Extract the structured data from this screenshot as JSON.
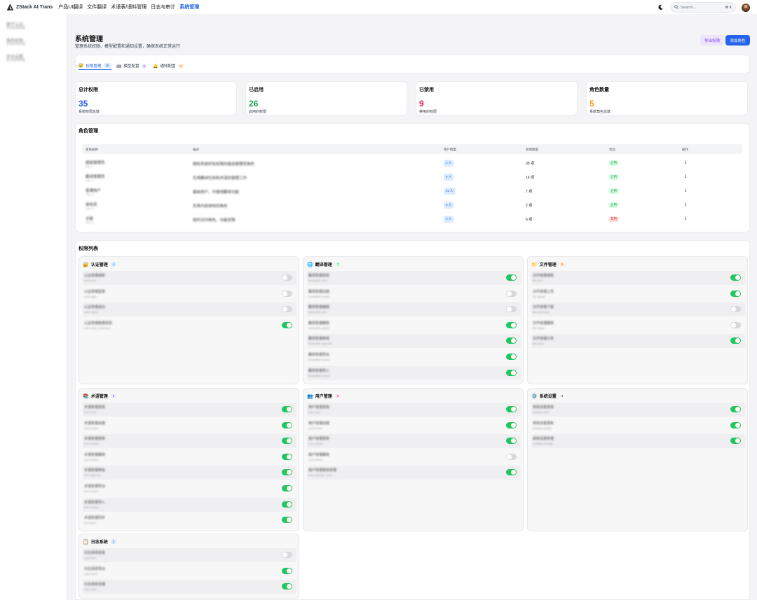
{
  "app": {
    "name": "ZStack AI Trans"
  },
  "nav": [
    {
      "label": "产品UI翻译",
      "active": false
    },
    {
      "label": "文件翻译",
      "active": false
    },
    {
      "label": "术语表/语料管理",
      "active": false
    },
    {
      "label": "日志与审计",
      "active": false
    },
    {
      "label": "系统管理",
      "active": true
    }
  ],
  "search": {
    "placeholder": "Search...",
    "shortcut": "⌘ K"
  },
  "sidebar": {
    "items": [
      {
        "title": "基于认证",
        "sub": "系统基础配置"
      },
      {
        "title": "角色权限",
        "sub": "系统权限管理"
      },
      {
        "title": "安全设置",
        "sub": "安全策略配置"
      }
    ]
  },
  "page": {
    "title": "系统管理",
    "subtitle": "管理系统权限、模型配置和通知设置，确保系统正常运行",
    "export_label": "导出权限",
    "add_label": "添加角色"
  },
  "tabs": [
    {
      "icon": "🔐",
      "label": "权限管理",
      "count": "35",
      "active": true
    },
    {
      "icon": "🤖",
      "label": "模型配置",
      "count": "6",
      "active": false
    },
    {
      "icon": "🔔",
      "label": "通知配置",
      "count": "3",
      "active": false
    }
  ],
  "stats": [
    {
      "label": "总计权限",
      "value": "35",
      "desc": "系统权限总数",
      "color": "#2563eb"
    },
    {
      "label": "已启用",
      "value": "26",
      "desc": "启用的权限",
      "color": "#16a34a"
    },
    {
      "label": "已禁用",
      "value": "9",
      "desc": "禁用的权限",
      "color": "#e11d48"
    },
    {
      "label": "角色数量",
      "value": "5",
      "desc": "系统角色总数",
      "color": "#f59e0b"
    }
  ],
  "roles": {
    "title": "角色管理",
    "headers": [
      "角色名称",
      "描述",
      "用户数量",
      "权限数量",
      "状态",
      "操作"
    ],
    "rows": [
      {
        "name": "超级管理员",
        "code": "role_1",
        "desc": "拥有系统所有权限的最高管理员角色",
        "users": "2 人",
        "perms": "35 项",
        "status": "启用",
        "enabled": true
      },
      {
        "name": "翻译管理员",
        "code": "role_2",
        "desc": "负责翻译任务和术语的管理工作",
        "users": "5 人",
        "perms": "16 项",
        "status": "启用",
        "enabled": true
      },
      {
        "name": "普通用户",
        "code": "role_3",
        "desc": "基础用户，可使用翻译功能",
        "users": "25 人",
        "perms": "7 项",
        "status": "启用",
        "enabled": true
      },
      {
        "name": "审核员",
        "code": "role_4",
        "desc": "负责内容审核的角色",
        "users": "8 人",
        "perms": "2 项",
        "status": "启用",
        "enabled": true
      },
      {
        "name": "访客",
        "code": "role_5",
        "desc": "临时访问角色，功能受限",
        "users": "3 人",
        "perms": "6 项",
        "status": "禁用",
        "enabled": false
      }
    ]
  },
  "permissions": {
    "title": "权限列表",
    "groups": [
      {
        "icon": "🔐",
        "name": "认证管理",
        "count": "4",
        "count_bg": "#dbeafe",
        "count_color": "#2563eb",
        "items": [
          {
            "name": "认证管理读取",
            "code": "auth.read",
            "on": false
          },
          {
            "name": "认证管理登录",
            "code": "auth.login",
            "on": false
          },
          {
            "name": "认证管理退出",
            "code": "auth.logout",
            "on": false
          },
          {
            "name": "认证管理重置密码",
            "code": "auth.reset_password",
            "on": true
          }
        ]
      },
      {
        "icon": "🌐",
        "name": "翻译管理",
        "count": "7",
        "count_bg": "#dcfce7",
        "count_color": "#16a34a",
        "items": [
          {
            "name": "翻译管理查看",
            "code": "translation.view",
            "on": true
          },
          {
            "name": "翻译管理创建",
            "code": "translation.create",
            "on": false
          },
          {
            "name": "翻译管理编辑",
            "code": "translation.edit",
            "on": false
          },
          {
            "name": "翻译管理删除",
            "code": "translation.delete",
            "on": true
          },
          {
            "name": "翻译管理审核",
            "code": "translation.approve",
            "on": true
          },
          {
            "name": "翻译管理导出",
            "code": "translation.export",
            "on": true
          },
          {
            "name": "翻译管理导入",
            "code": "translation.import",
            "on": true
          }
        ]
      },
      {
        "icon": "📁",
        "name": "文件管理",
        "count": "5",
        "count_bg": "#ffedd5",
        "count_color": "#ea580c",
        "items": [
          {
            "name": "文件管理读取",
            "code": "file.read",
            "on": true
          },
          {
            "name": "文件管理上传",
            "code": "file.upload",
            "on": true
          },
          {
            "name": "文件管理下载",
            "code": "file.download",
            "on": false
          },
          {
            "name": "文件管理删除",
            "code": "file.delete",
            "on": false
          },
          {
            "name": "文件管理分享",
            "code": "file.share",
            "on": true
          }
        ]
      },
      {
        "icon": "📚",
        "name": "术语管理",
        "count": "8",
        "count_bg": "#ede9fe",
        "count_color": "#7c3aed",
        "items": [
          {
            "name": "术语管理查看",
            "code": "term.view",
            "on": true
          },
          {
            "name": "术语管理创建",
            "code": "term.create",
            "on": true
          },
          {
            "name": "术语管理更新",
            "code": "term.update",
            "on": true
          },
          {
            "name": "术语管理删除",
            "code": "term.delete",
            "on": true
          },
          {
            "name": "术语管理审批",
            "code": "term.approve",
            "on": true
          },
          {
            "name": "术语管理导出",
            "code": "term.export",
            "on": true
          },
          {
            "name": "术语管理导入",
            "code": "term.import",
            "on": true
          },
          {
            "name": "术语管理同步",
            "code": "term.sync",
            "on": true
          }
        ]
      },
      {
        "icon": "👥",
        "name": "用户管理",
        "count": "5",
        "count_bg": "#fce7f3",
        "count_color": "#db2777",
        "items": [
          {
            "name": "用户管理查看",
            "code": "user.view",
            "on": true
          },
          {
            "name": "用户管理创建",
            "code": "user.create",
            "on": true
          },
          {
            "name": "用户管理更新",
            "code": "user.update",
            "on": true
          },
          {
            "name": "用户管理删除",
            "code": "user.delete",
            "on": false
          },
          {
            "name": "用户管理角色管理",
            "code": "user.manage_roles",
            "on": true
          }
        ]
      },
      {
        "icon": "⚙️",
        "name": "系统设置",
        "count": "3",
        "count_bg": "#f3f4f6",
        "count_color": "#374151",
        "items": [
          {
            "name": "系统设置查看",
            "code": "settings.view",
            "on": true
          },
          {
            "name": "系统设置更新",
            "code": "settings.update",
            "on": true
          },
          {
            "name": "系统设置管理",
            "code": "settings.manage",
            "on": true
          }
        ]
      },
      {
        "icon": "📋",
        "name": "日志系统",
        "count": "3",
        "count_bg": "#dbeafe",
        "count_color": "#2563eb",
        "items": [
          {
            "name": "日志系统查看",
            "code": "logs.view",
            "on": false
          },
          {
            "name": "日志系统导出",
            "code": "logs.export",
            "on": true
          },
          {
            "name": "日志系统清理",
            "code": "logs.clean",
            "on": true
          }
        ]
      }
    ]
  }
}
